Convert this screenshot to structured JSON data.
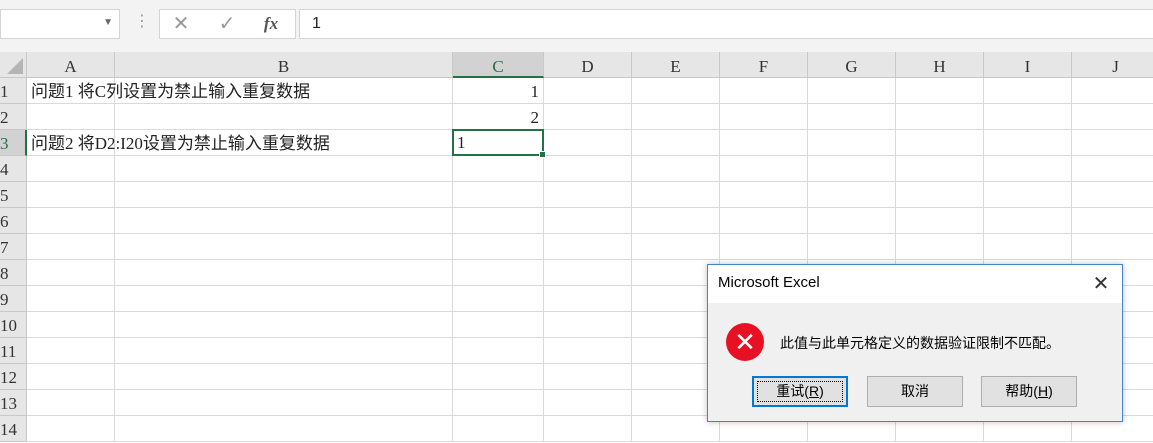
{
  "formula_bar": {
    "name_box": "",
    "dropdown_icon": "chevron-down-icon",
    "separator_icon": "vertical-dots-icon",
    "cancel_icon": "✕",
    "enter_icon": "✓",
    "function_icon": "fx",
    "value": "1"
  },
  "columns": [
    "A",
    "B",
    "C",
    "D",
    "E",
    "F",
    "G",
    "H",
    "I",
    "J"
  ],
  "selected_column": "C",
  "rows": [
    "1",
    "2",
    "3",
    "4",
    "5",
    "6",
    "7",
    "8",
    "9",
    "10",
    "11",
    "12",
    "13",
    "14"
  ],
  "selected_row": "3",
  "cells": {
    "A1": "问题1 将C列设置为禁止输入重复数据",
    "C1": "1",
    "C2": "2",
    "A3": "问题2 将D2:I20设置为禁止输入重复数据",
    "C3": "1"
  },
  "active_cell": "C3",
  "dialog": {
    "title": "Microsoft Excel",
    "close_icon": "✕",
    "error_icon": "✕",
    "message": "此值与此单元格定义的数据验证限制不匹配。",
    "buttons": {
      "retry": {
        "label": "重试(",
        "key": "R",
        "tail": ")"
      },
      "cancel": {
        "label": "取消"
      },
      "help": {
        "label": "帮助(",
        "key": "H",
        "tail": ")"
      }
    }
  },
  "colors": {
    "accent": "#217346",
    "error": "#e81123",
    "dialog_border": "#3f88c8"
  }
}
